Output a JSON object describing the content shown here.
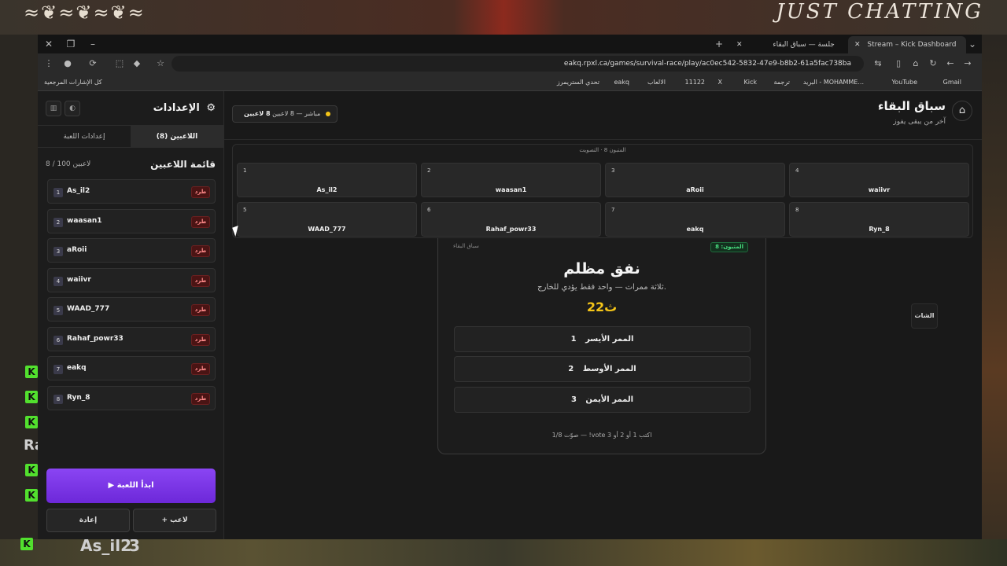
{
  "stream": {
    "stamp": "JUST CHATTING",
    "chat_user": "As_il2",
    "chat_number": "3",
    "chat_partial": "Ra"
  },
  "browser": {
    "tabs": [
      {
        "label": "Stream – Kick Dashboard"
      },
      {
        "label": "جلسة — سباق البقاء"
      }
    ],
    "url": "eakq.rpxl.ca/games/survival-race/play/ac0ec542-5832-47e9-b8b2-61a5fac738ba",
    "bookmarks": [
      "Gmail",
      "YouTube",
      "البريد - MOHAMME...",
      "ترجمة",
      "Kick",
      "X",
      "11122",
      "الالعاب",
      "eakq",
      "تحدي الستريمرز",
      "كل الإشارات المرجعية"
    ]
  },
  "sidebar": {
    "title": "الإعدادات",
    "tab_players": "اللاعبين (8)",
    "tab_settings": "إعدادات اللعبة",
    "list_title": "قائمة اللاعبين",
    "count": "8 / 100 لاعبين",
    "players": [
      {
        "num": "1",
        "name": "As_il2"
      },
      {
        "num": "2",
        "name": "waasan1"
      },
      {
        "num": "3",
        "name": "aRoii"
      },
      {
        "num": "4",
        "name": "waiivr"
      },
      {
        "num": "5",
        "name": "WAAD_777"
      },
      {
        "num": "6",
        "name": "Rahaf_powr33"
      },
      {
        "num": "7",
        "name": "eakq"
      },
      {
        "num": "8",
        "name": "Ryn_8"
      }
    ],
    "kick_label": "طرد",
    "start_label": "▶ ابدأ اللعبة",
    "add_player_label": "+ لاعب",
    "reset_label": "إعادة"
  },
  "header": {
    "title": "سباق البقاء",
    "subtitle": "آخر من يبقى يفوز",
    "status_count": "8 لاعبين",
    "status_text": "مباشر — 8 لاعبين"
  },
  "grid": {
    "caption": "المتبون 8 · التصويت",
    "cells": [
      {
        "num": "1",
        "name": "As_il2"
      },
      {
        "num": "2",
        "name": "waasan1"
      },
      {
        "num": "3",
        "name": "aRoii"
      },
      {
        "num": "4",
        "name": "waiivr"
      },
      {
        "num": "5",
        "name": "WAAD_777"
      },
      {
        "num": "6",
        "name": "Rahaf_powr33"
      },
      {
        "num": "7",
        "name": "eakq"
      },
      {
        "num": "8",
        "name": "Ryn_8"
      }
    ]
  },
  "question": {
    "tag": "سباق البقاء",
    "alive": "المتبون: 8",
    "title": "نفق مظلم",
    "description": "ثلاثة ممرات — واحد فقط يؤدي للخارج.",
    "timer": "22ث",
    "options": [
      {
        "label": "الممر الأيسر",
        "num": "1"
      },
      {
        "label": "الممر الأوسط",
        "num": "2"
      },
      {
        "label": "الممر الأيمن",
        "num": "3"
      }
    ],
    "footer": "صوّت 1/8 — !vote اكتب 1 أو 2 أو 3"
  },
  "chat_button": "الشات"
}
